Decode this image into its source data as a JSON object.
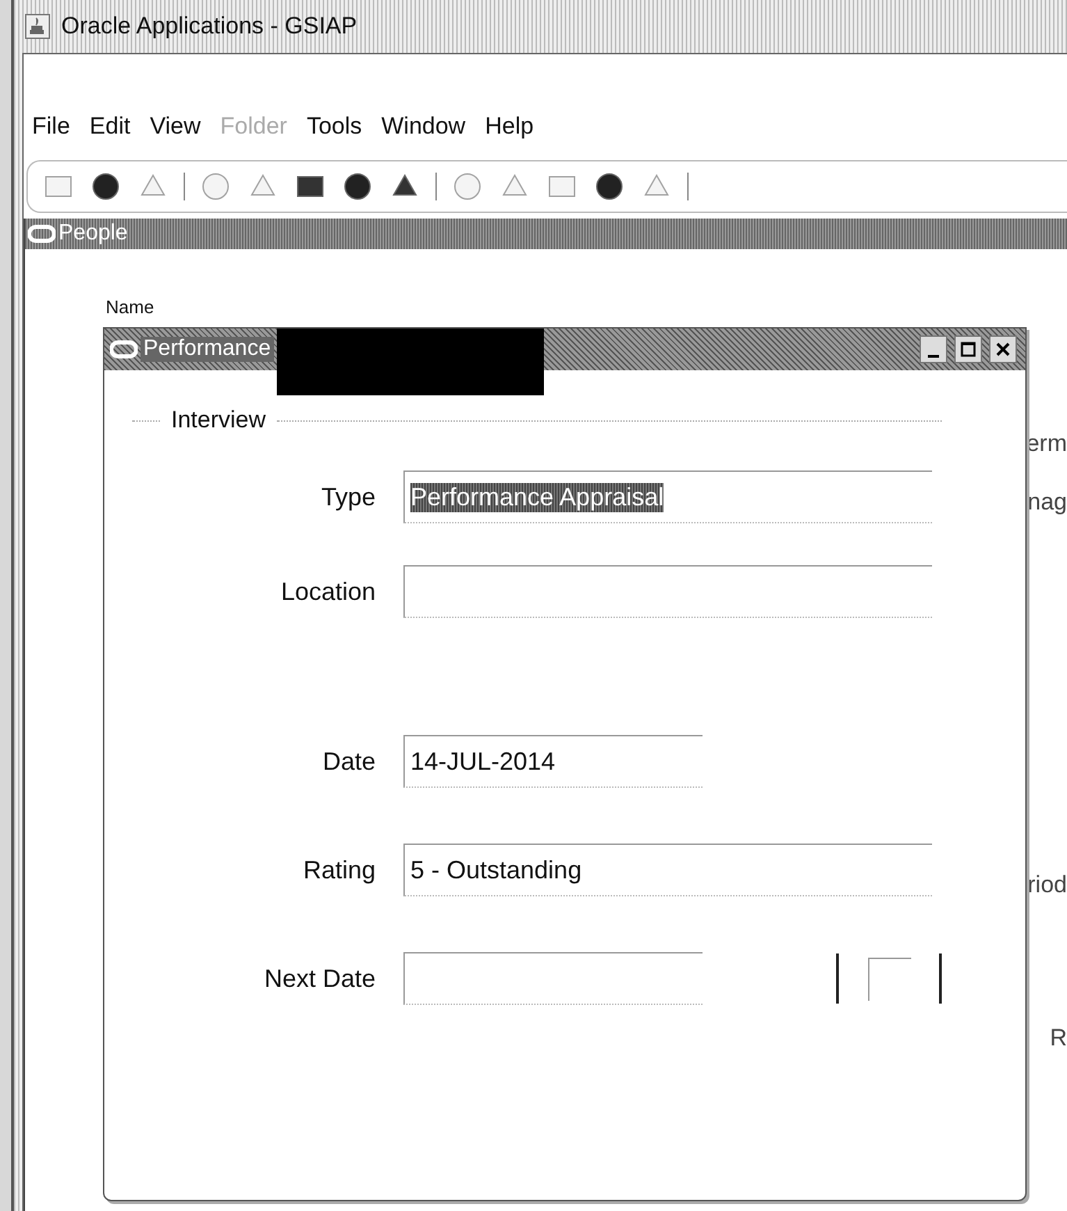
{
  "window": {
    "title": "Oracle Applications - GSIAP"
  },
  "menu": [
    {
      "label": "File",
      "disabled": false
    },
    {
      "label": "Edit",
      "disabled": false
    },
    {
      "label": "View",
      "disabled": false
    },
    {
      "label": "Folder",
      "disabled": true
    },
    {
      "label": "Tools",
      "disabled": false
    },
    {
      "label": "Window",
      "disabled": false
    },
    {
      "label": "Help",
      "disabled": false
    }
  ],
  "toolbar": [
    {
      "kind": "tool",
      "disabled": true
    },
    {
      "kind": "tool",
      "disabled": false
    },
    {
      "kind": "tool",
      "disabled": true
    },
    {
      "kind": "separator"
    },
    {
      "kind": "tool",
      "disabled": true
    },
    {
      "kind": "tool",
      "disabled": true
    },
    {
      "kind": "tool",
      "disabled": false
    },
    {
      "kind": "tool",
      "disabled": false
    },
    {
      "kind": "tool",
      "disabled": false
    },
    {
      "kind": "separator"
    },
    {
      "kind": "tool",
      "disabled": true
    },
    {
      "kind": "tool",
      "disabled": true
    },
    {
      "kind": "tool",
      "disabled": true
    },
    {
      "kind": "tool",
      "disabled": false
    },
    {
      "kind": "tool",
      "disabled": true
    },
    {
      "kind": "separator"
    }
  ],
  "people_window": {
    "title": "People",
    "label_top": "Name",
    "fragments": [
      "erm",
      "nag",
      "riod",
      "R"
    ]
  },
  "dialog": {
    "title": "Performance",
    "redacted": true,
    "section": "Interview",
    "fields": [
      {
        "label": "Type",
        "value": "Performance Appraisal",
        "kind": "long",
        "text_selected": true
      },
      {
        "label": "Location",
        "kind": "long"
      },
      {
        "label": "Date",
        "value": "14-JUL-2014",
        "kind": "short"
      },
      {
        "label": "Rating",
        "value": "5 - Outstanding",
        "kind": "long"
      },
      {
        "label": "Next Date",
        "kind": "short",
        "flex_field": true
      }
    ]
  }
}
